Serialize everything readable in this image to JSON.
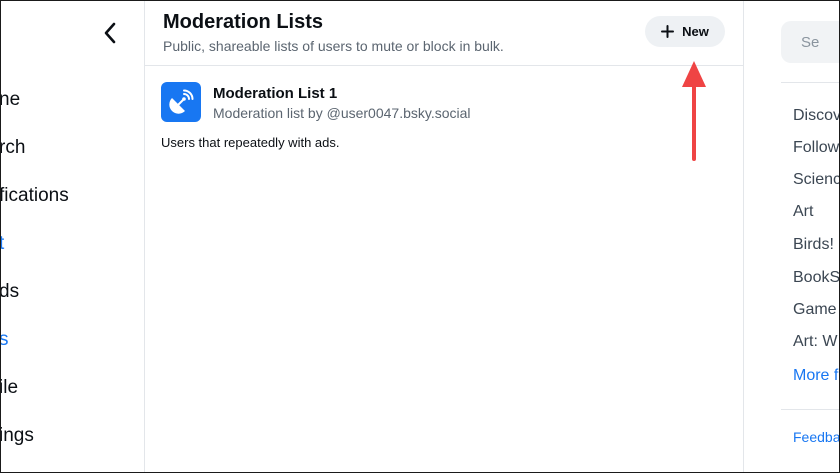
{
  "left_nav": {
    "items": [
      {
        "label": "ne",
        "active": false
      },
      {
        "label": "rch",
        "active": false
      },
      {
        "label": "fications",
        "active": false
      },
      {
        "label": "t",
        "active": true
      },
      {
        "label": "ds",
        "active": false
      },
      {
        "label": "s",
        "active": true
      },
      {
        "label": "ile",
        "active": false
      },
      {
        "label": "ings",
        "active": false
      }
    ]
  },
  "header": {
    "title": "Moderation Lists",
    "subtitle": "Public, shareable lists of users to mute or block in bulk.",
    "new_label": "New"
  },
  "lists": [
    {
      "name": "Moderation List 1",
      "owner": "Moderation list by @user0047.bsky.social",
      "description": "Users that repeatedly with ads."
    }
  ],
  "right_sidebar": {
    "search_placeholder": "Se",
    "feeds": [
      "Discov",
      "Follow",
      "Scienc",
      "Art",
      "Birds!",
      "BookS",
      "Game",
      "Art: W"
    ],
    "more_label": "More f",
    "feedback_label": "Feedba"
  },
  "colors": {
    "accent": "#1877f2",
    "annotation_arrow": "#ef4444",
    "button_bg": "#eef1f4"
  }
}
